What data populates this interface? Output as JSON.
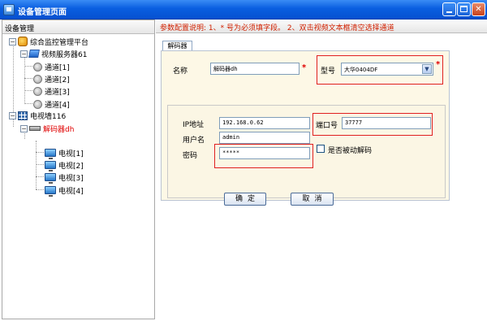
{
  "window": {
    "title": "设备管理页面",
    "minimize": "",
    "maximize": "",
    "close": "✕"
  },
  "left": {
    "header": "设备管理",
    "tree": {
      "root": "综合监控管理平台",
      "server": "视频服务器61",
      "channels": [
        "通道[1]",
        "通道[2]",
        "通道[3]",
        "通道[4]"
      ],
      "wall": "电视墙116",
      "decoder": "解码器dh",
      "tvs": [
        "电视[1]",
        "电视[2]",
        "电视[3]",
        "电视[4]"
      ],
      "collapse_glyph": "−"
    }
  },
  "right": {
    "hint": "参数配置说明: 1、* 号为必须填字段。 2、双击视频文本框清空选择通道",
    "tab_label": "解码器",
    "form": {
      "name_label": "名称",
      "name_value": "解码器dh",
      "model_label": "型号",
      "model_value": "大华0404DF",
      "ip_label": "IP地址",
      "ip_value": "192.168.0.62",
      "port_label": "端口号",
      "port_value": "37777",
      "user_label": "用户名",
      "user_value": "admin",
      "password_label": "密码",
      "password_value": "*****",
      "passive_label": "是否被动解码",
      "required_mark": "*",
      "dropdown_glyph": "▼"
    },
    "buttons": {
      "ok": "确定",
      "cancel": "取消"
    }
  },
  "colors": {
    "titlebar": "#0a5ee0",
    "hint_text": "#d02000",
    "form_bg": "#fdf8e6",
    "highlight_border": "#e02020"
  }
}
